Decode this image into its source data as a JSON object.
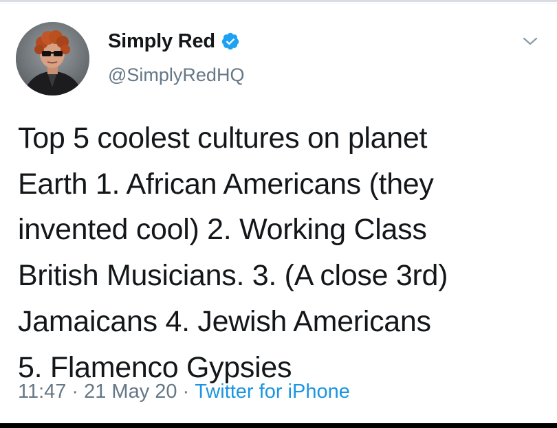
{
  "user": {
    "display_name": "Simply Red",
    "handle": "@SimplyRedHQ",
    "verified": true,
    "avatar_icon": "profile-photo"
  },
  "tweet": {
    "text": "Top 5 coolest cultures on planet\nEarth 1. African Americans (they\ninvented cool) 2. Working Class\nBritish Musicians. 3. (A close 3rd)\nJamaicans 4. Jewish Americans\n5. Flamenco Gypsies",
    "time": "11:47",
    "separator": "·",
    "date": "21 May 20",
    "source": "Twitter for iPhone"
  },
  "colors": {
    "text": "#14171a",
    "secondary": "#657786",
    "link": "#1b95e0",
    "verified": "#1da1f2"
  },
  "icons": {
    "verified": "verified-badge-icon",
    "menu": "chevron-down-icon"
  }
}
